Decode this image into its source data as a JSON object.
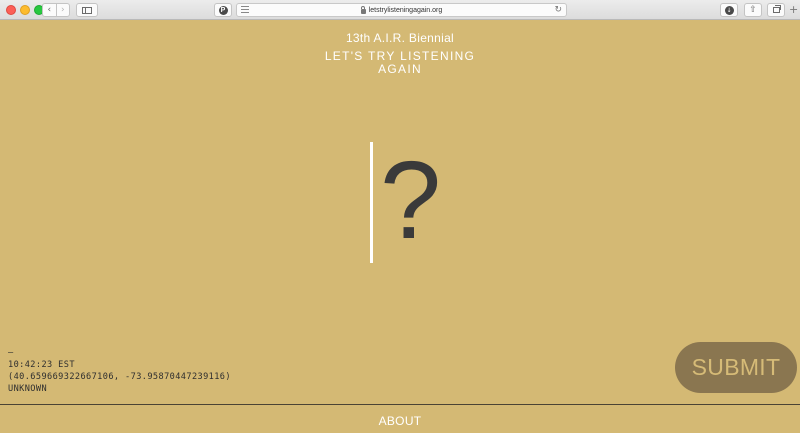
{
  "browser": {
    "url": "letstrylisteningagain.org",
    "icons": {
      "back": "‹",
      "forward": "›",
      "pin": "P",
      "download": "↓",
      "share": "⇧",
      "reload": "↻",
      "new_tab": "+"
    }
  },
  "header": {
    "subtitle": "13th A.I.R. Biennial",
    "title_line1": "LET'S TRY LISTENING",
    "title_line2": "AGAIN"
  },
  "main": {
    "question_mark": "?"
  },
  "info": {
    "marker": "—",
    "time": "10:42:23 EST",
    "coordinates": "(40.659669322667106, -73.95870447239116)",
    "location": "UNKNOWN"
  },
  "actions": {
    "submit_label": "SUBMIT"
  },
  "footer": {
    "about_label": "ABOUT"
  },
  "colors": {
    "background": "#d4b974",
    "submit_bg": "#8a7650",
    "text_light": "#ffffff",
    "text_dark": "#3a3a3a"
  }
}
